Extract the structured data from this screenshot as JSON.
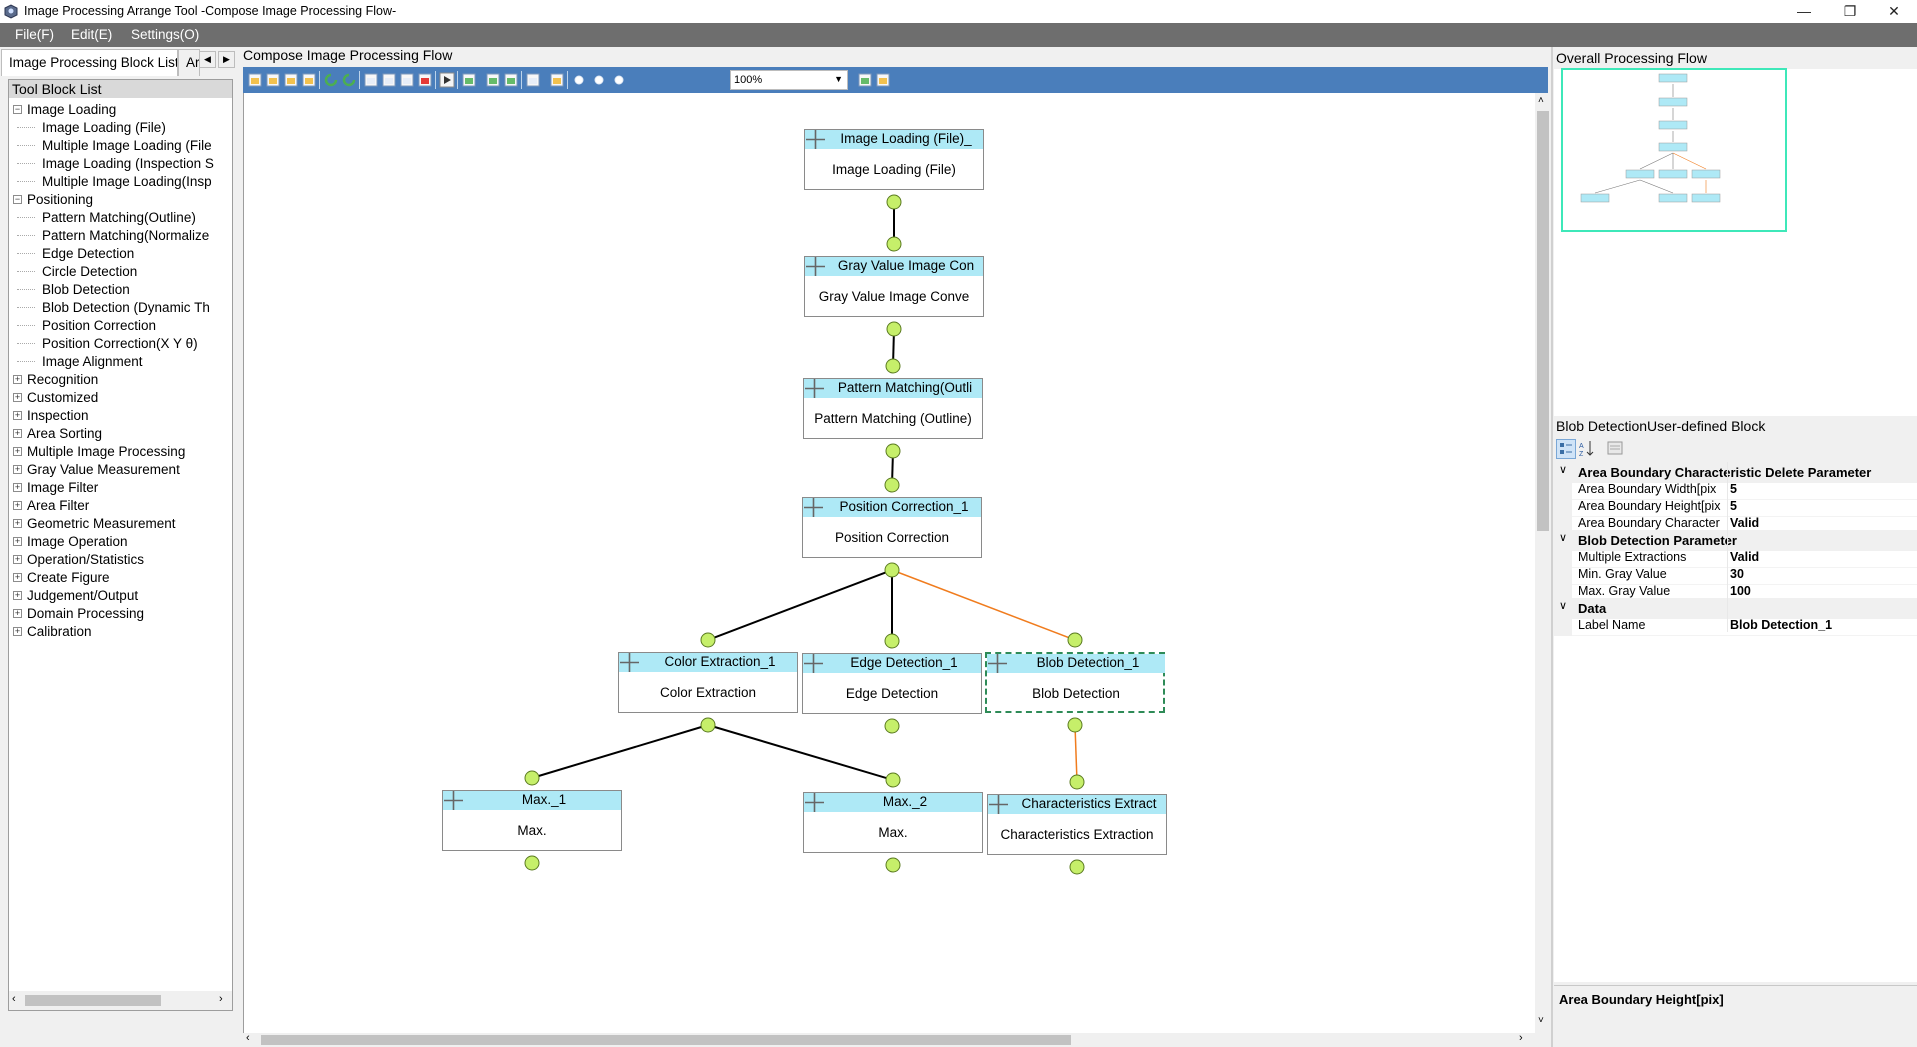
{
  "window": {
    "title": "Image Processing Arrange Tool -Compose Image Processing Flow-",
    "controls": [
      "—",
      "❐",
      "✕"
    ]
  },
  "menu": [
    "File(F)",
    "Edit(E)",
    "Settings(O)"
  ],
  "left": {
    "tabs": [
      "Image Processing Block List",
      "Ar"
    ],
    "header": "Tool Block List",
    "tree": [
      {
        "label": "Image Loading",
        "level": 0,
        "expander": "−"
      },
      {
        "label": "Image Loading (File)",
        "level": 1
      },
      {
        "label": "Multiple Image Loading (File",
        "level": 1
      },
      {
        "label": "Image Loading (Inspection S",
        "level": 1
      },
      {
        "label": "Multiple Image Loading(Insp",
        "level": 1
      },
      {
        "label": "Positioning",
        "level": 0,
        "expander": "−"
      },
      {
        "label": "Pattern Matching(Outline)",
        "level": 1
      },
      {
        "label": "Pattern Matching(Normalize",
        "level": 1
      },
      {
        "label": "Edge Detection",
        "level": 1
      },
      {
        "label": "Circle Detection",
        "level": 1
      },
      {
        "label": "Blob Detection",
        "level": 1
      },
      {
        "label": "Blob Detection (Dynamic Th",
        "level": 1
      },
      {
        "label": "Position Correction",
        "level": 1
      },
      {
        "label": "Position Correction(X Y θ)",
        "level": 1
      },
      {
        "label": "Image Alignment",
        "level": 1
      },
      {
        "label": "Recognition",
        "level": 0,
        "expander": "+"
      },
      {
        "label": "Customized",
        "level": 0,
        "expander": "+"
      },
      {
        "label": "Inspection",
        "level": 0,
        "expander": "+"
      },
      {
        "label": "Area Sorting",
        "level": 0,
        "expander": "+"
      },
      {
        "label": "Multiple Image Processing",
        "level": 0,
        "expander": "+"
      },
      {
        "label": "Gray Value Measurement",
        "level": 0,
        "expander": "+"
      },
      {
        "label": "Image Filter",
        "level": 0,
        "expander": "+"
      },
      {
        "label": "Area Filter",
        "level": 0,
        "expander": "+"
      },
      {
        "label": "Geometric Measurement",
        "level": 0,
        "expander": "+"
      },
      {
        "label": "Image Operation",
        "level": 0,
        "expander": "+"
      },
      {
        "label": "Operation/Statistics",
        "level": 0,
        "expander": "+"
      },
      {
        "label": "Create Figure",
        "level": 0,
        "expander": "+"
      },
      {
        "label": "Judgement/Output",
        "level": 0,
        "expander": "+"
      },
      {
        "label": "Domain Processing",
        "level": 0,
        "expander": "+"
      },
      {
        "label": "Calibration",
        "level": 0,
        "expander": "+"
      }
    ]
  },
  "center": {
    "title": "Compose Image Processing Flow",
    "zoom": "100%",
    "blocks": [
      {
        "id": "image-loading",
        "head": "Image Loading (File)_",
        "body": "Image Loading (File)",
        "selected": false
      },
      {
        "id": "gray-value",
        "head": "Gray Value Image Con",
        "body": "Gray Value Image Conve",
        "selected": false
      },
      {
        "id": "pattern-matching",
        "head": "Pattern Matching(Outli",
        "body": "Pattern Matching (Outline)",
        "selected": false
      },
      {
        "id": "position-correction",
        "head": "Position Correction_1",
        "body": "Position Correction",
        "selected": false
      },
      {
        "id": "color-extraction",
        "head": "Color Extraction_1",
        "body": "Color Extraction",
        "selected": false
      },
      {
        "id": "edge-detection",
        "head": "Edge Detection_1",
        "body": "Edge Detection",
        "selected": false
      },
      {
        "id": "blob-detection",
        "head": "Blob Detection_1",
        "body": "Blob Detection",
        "selected": true
      },
      {
        "id": "max-1",
        "head": "Max._1",
        "body": "Max.",
        "selected": false
      },
      {
        "id": "max-2",
        "head": "Max._2",
        "body": "Max.",
        "selected": false
      },
      {
        "id": "characteristics",
        "head": "Characteristics Extract",
        "body": "Characteristics Extraction",
        "selected": false
      }
    ],
    "link_colors": {
      "normal": "#000000",
      "selected": "#f07c1e"
    }
  },
  "right": {
    "overview_title": "Overall Processing Flow",
    "property_title": "Blob DetectionUser-defined Block",
    "categories": [
      {
        "name": "Area Boundary Characteristic Delete Parameter",
        "rows": [
          {
            "label": "Area Boundary Width[pix",
            "value": "5"
          },
          {
            "label": "Area Boundary Height[pix",
            "value": "5"
          },
          {
            "label": "Area Boundary Character",
            "value": "Valid"
          }
        ]
      },
      {
        "name": "Blob Detection Parameter",
        "rows": [
          {
            "label": "Multiple Extractions",
            "value": "Valid"
          },
          {
            "label": "Min. Gray Value",
            "value": "30"
          },
          {
            "label": "Max. Gray Value",
            "value": "100"
          }
        ]
      },
      {
        "name": "Data",
        "rows": [
          {
            "label": "Label Name",
            "value": "Blob Detection_1"
          }
        ]
      }
    ],
    "description_title": "Area Boundary Height[pix]"
  },
  "colors": {
    "block_header": "#aee9f6",
    "port": "#c6ef6a",
    "toolbar": "#4a7ebb",
    "menubar": "#6e6e6e",
    "overview_frame": "#3ee8b9"
  }
}
